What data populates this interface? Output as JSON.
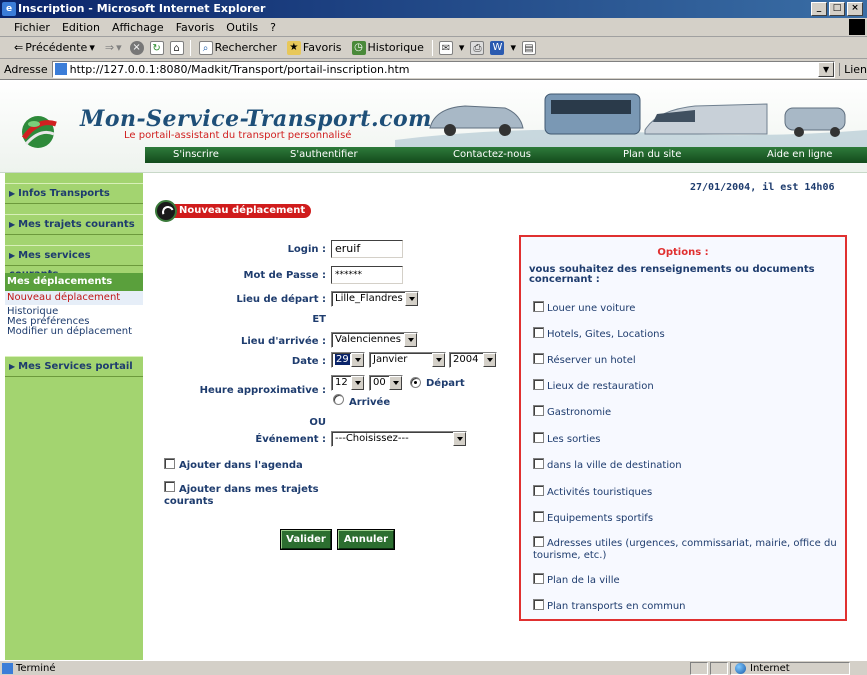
{
  "window": {
    "title": "Inscription - Microsoft Internet Explorer",
    "controls": [
      "_",
      "□",
      "×"
    ]
  },
  "menubar": {
    "items": [
      "Fichier",
      "Edition",
      "Affichage",
      "Favoris",
      "Outils",
      "?"
    ]
  },
  "toolbar": {
    "back_label": "Précédente",
    "search_label": "Rechercher",
    "favorites_label": "Favoris",
    "history_label": "Historique"
  },
  "addressbar": {
    "label": "Adresse",
    "url": "http://127.0.0.1:8080/Madkit/Transport/portail-inscription.htm",
    "links_label": "Lien"
  },
  "banner": {
    "brand": "Mon-Service-Transport.com",
    "tagline": "Le portail-assistant du transport personnalisé",
    "nav": [
      "S'inscrire",
      "S'authentifier",
      "Contactez-nous",
      "Plan du site",
      "Aide en ligne"
    ]
  },
  "leftnav": {
    "infos_transports": "Infos Transports",
    "mes_trajets": "Mes trajets courants",
    "mes_services": "Mes services courants",
    "deps_header": "Mes déplacements",
    "deps_active": "Nouveau déplacement",
    "deps_items": [
      "Historique",
      "Mes préférences",
      "Modifier un déplacement"
    ],
    "services_portail": "Mes Services portail"
  },
  "main": {
    "datetime": "27/01/2004, il est 14h06",
    "section_title": "Nouveau déplacement",
    "login_label": "Login :",
    "login_value": "eruif",
    "password_label": "Mot de Passe :",
    "password_value": "******",
    "depart_label": "Lieu de départ :",
    "depart_value": "Lille_Flandres",
    "et": "ET",
    "arrivee_label": "Lieu d'arrivée :",
    "arrivee_value": "Valenciennes",
    "date_label": "Date :",
    "date_day": "29",
    "date_month": "Janvier",
    "date_year": "2004",
    "heure_label": "Heure approximative :",
    "heure_h": "12",
    "heure_m": "00",
    "depart_radio": "Départ",
    "arrivee_radio": "Arrivée",
    "ou": "OU",
    "evenement_label": "Événement :",
    "evenement_value": "---Choisissez---",
    "agenda_label": "Ajouter dans l'agenda",
    "trajets_label": "Ajouter dans mes trajets courants",
    "valider": "Valider",
    "annuler": "Annuler"
  },
  "options": {
    "title": "Options :",
    "intro": "vous souhaitez des renseignements ou documents concernant :",
    "items": [
      "Louer une voiture",
      "Hotels, Gites, Locations",
      "Réserver un hotel",
      "Lieux de restauration",
      "Gastronomie",
      "Les sorties",
      "dans la ville de destination",
      "Activités touristiques",
      "Equipements sportifs",
      "Adresses utiles (urgences, commissariat, mairie, office du tourisme, etc.)",
      "Plan de la ville",
      "Plan transports en commun"
    ]
  },
  "statusbar": {
    "text": "Terminé",
    "zone": "Internet"
  },
  "colors": {
    "accent_red": "#d01c1c",
    "nav_green": "#134a1c",
    "sidebar_green": "#a3d470",
    "text_navy": "#1e3c6e"
  }
}
